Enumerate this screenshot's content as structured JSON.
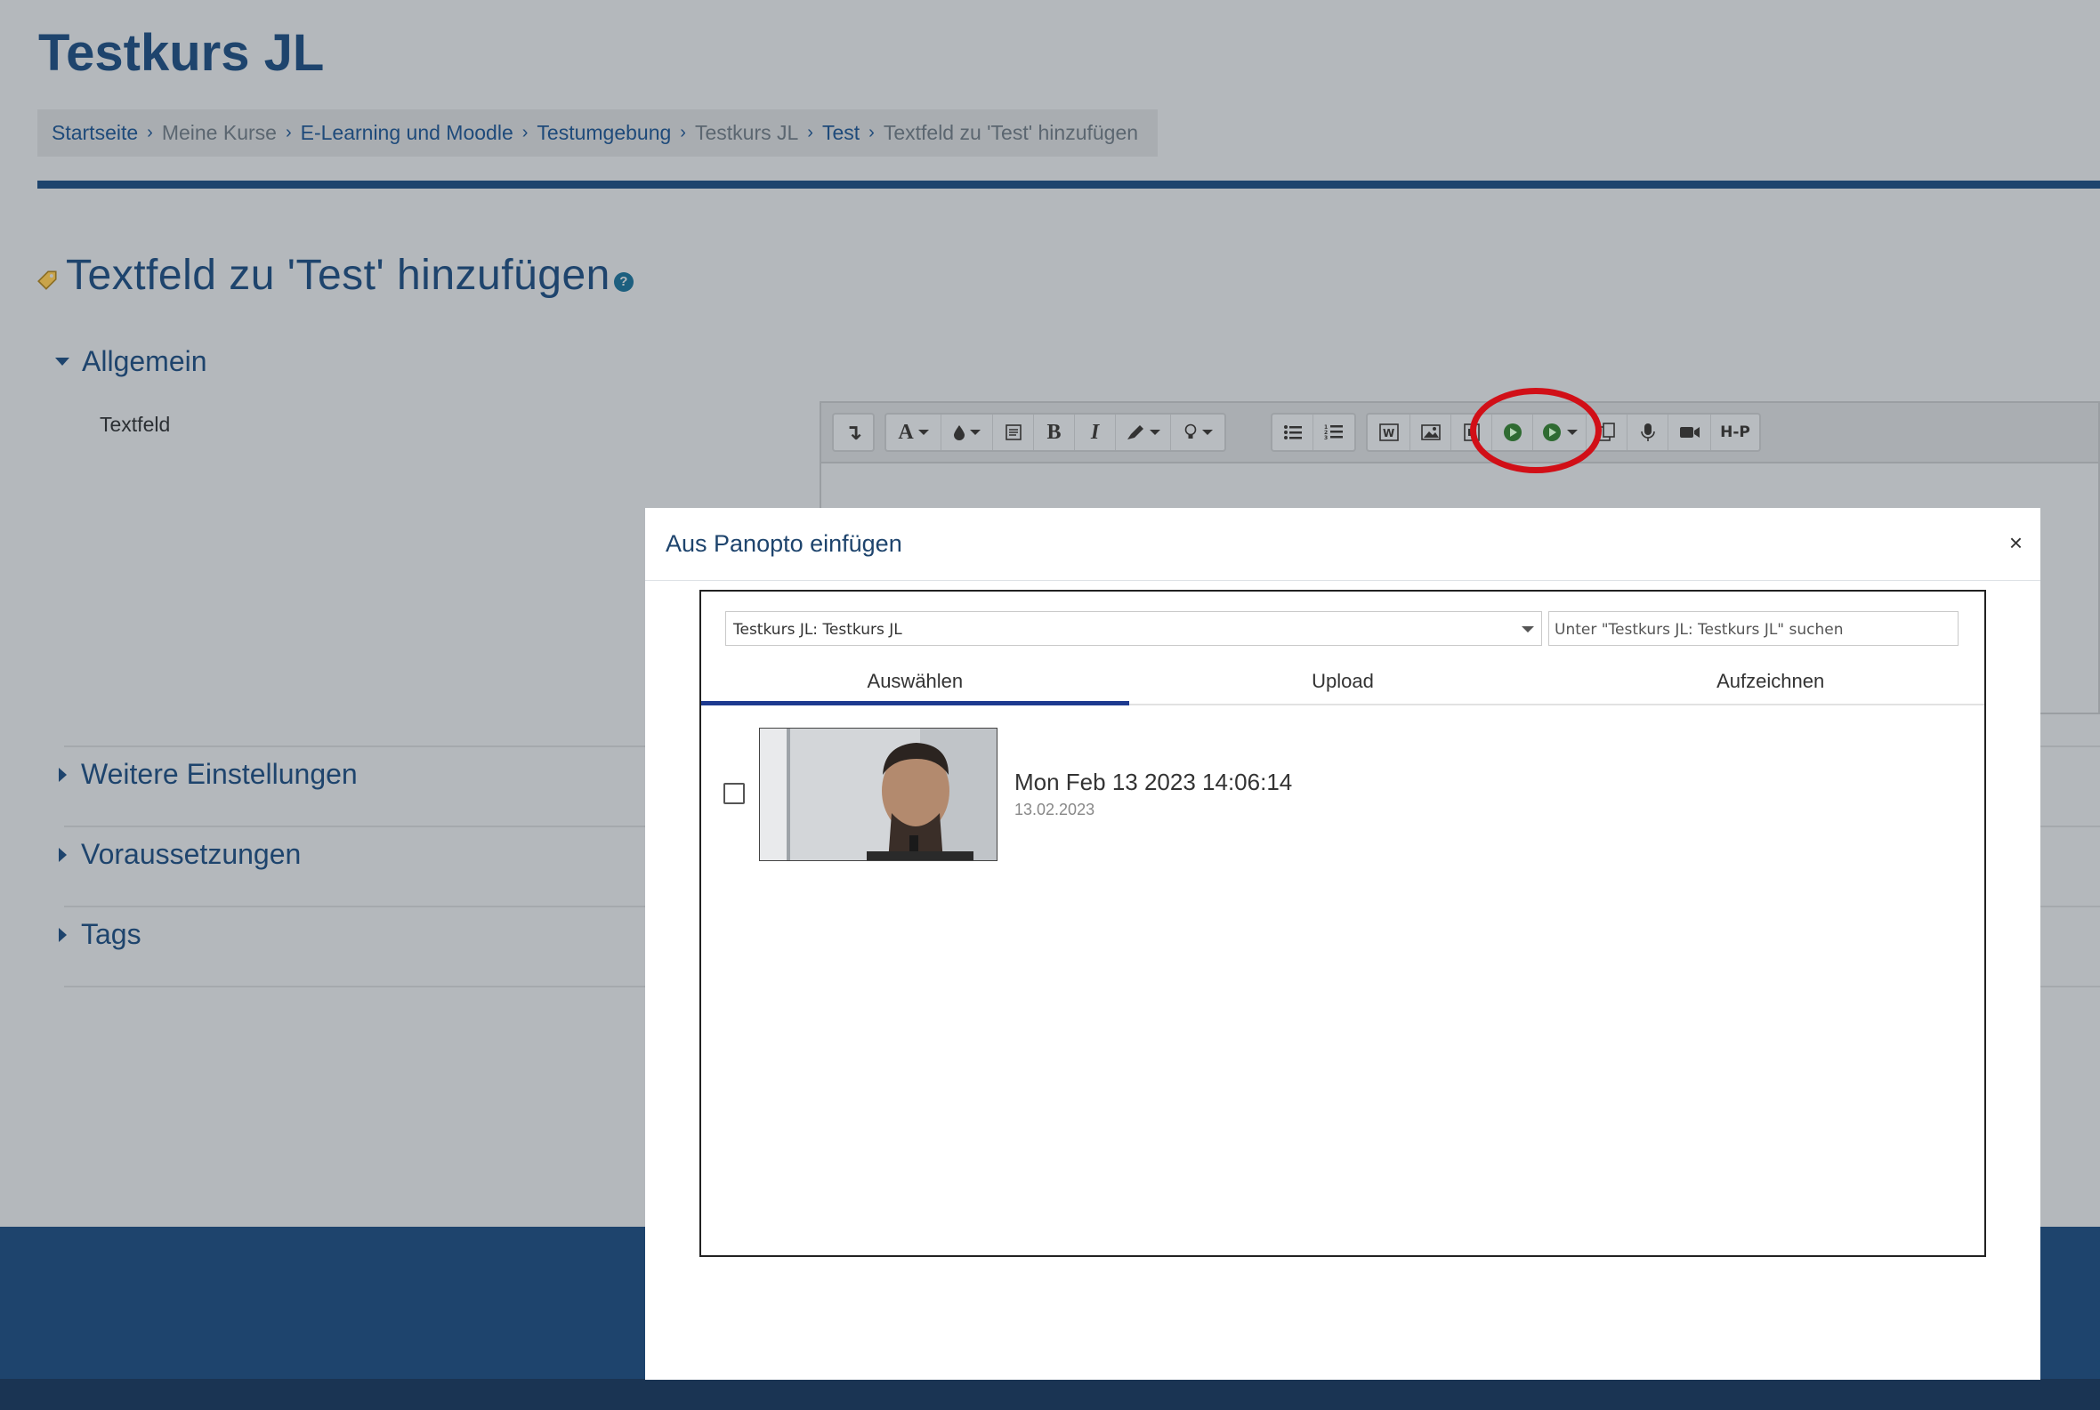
{
  "course": {
    "title": "Testkurs JL"
  },
  "breadcrumb": [
    {
      "label": "Startseite",
      "link": true
    },
    {
      "label": "Meine Kurse",
      "link": false
    },
    {
      "label": "E-Learning und Moodle",
      "link": true
    },
    {
      "label": "Testumgebung",
      "link": true
    },
    {
      "label": "Testkurs JL",
      "link": false
    },
    {
      "label": "Test",
      "link": true
    },
    {
      "label": "Textfeld zu 'Test' hinzufügen",
      "link": false
    }
  ],
  "page": {
    "heading": "Textfeld zu 'Test' hinzufügen",
    "help_glyph": "?"
  },
  "sections": {
    "general": "Allgemein",
    "field_label": "Textfeld",
    "more_settings": "Weitere Einstellungen",
    "restrictions": "Voraussetzungen",
    "tags": "Tags"
  },
  "toolbar": {
    "icons": [
      "collapse-icon",
      "font-style-icon",
      "font-color-icon",
      "paragraph-icon",
      "bold-icon",
      "italic-icon",
      "highlight-icon",
      "lightbulb-icon",
      "unordered-list-icon",
      "ordered-list-icon",
      "word-paste-icon",
      "image-icon",
      "media-icon",
      "panopto-icon",
      "panopto-dropdown-icon",
      "copy-icon",
      "microphone-icon",
      "video-camera-icon",
      "h5p-icon"
    ],
    "collapse_glyph": "↴",
    "font_glyph": "A",
    "bold_glyph": "B",
    "italic_glyph": "I",
    "h5p_glyph": "H-P"
  },
  "modal": {
    "title": "Aus Panopto einfügen",
    "close_glyph": "×",
    "folder_value": "Testkurs JL: Testkurs JL",
    "search_placeholder": "Unter \"Testkurs JL: Testkurs JL\" suchen",
    "tabs": [
      {
        "label": "Auswählen",
        "active": true
      },
      {
        "label": "Upload",
        "active": false
      },
      {
        "label": "Aufzeichnen",
        "active": false
      }
    ],
    "sessions": [
      {
        "title": "Mon Feb 13 2023 14:06:14",
        "date": "13.02.2023",
        "checked": false
      }
    ]
  },
  "colors": {
    "primary": "#1e446d",
    "highlight_circle": "#d10f17",
    "tab_active": "#1d3a8f"
  }
}
